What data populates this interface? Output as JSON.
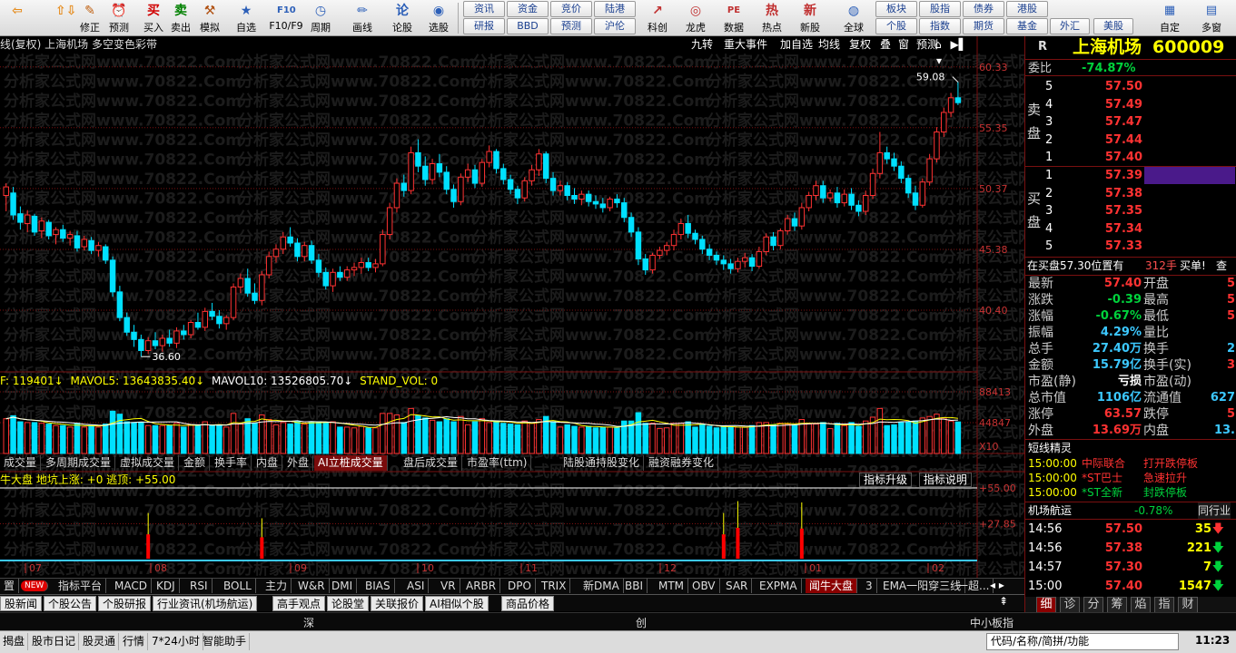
{
  "toolbar": {
    "groups": [
      {
        "label": "",
        "icon": "⇦",
        "color": "#e58a1a"
      },
      {
        "label": "",
        "icon": "⇧⇩",
        "color": "#e58a1a"
      },
      {
        "label": "修正",
        "icon": "✎",
        "color": "#c06010"
      },
      {
        "label": "预测",
        "icon": "⏰",
        "color": "#c03030"
      },
      {
        "label": "买入",
        "icon": "买",
        "color": "#d00000"
      },
      {
        "label": "卖出",
        "icon": "卖",
        "color": "#008000"
      },
      {
        "label": "模拟",
        "icon": "⚒",
        "color": "#b05010"
      },
      {
        "label": "自选",
        "icon": "★",
        "color": "#2c5fb8"
      },
      {
        "label": "F10/F9",
        "icon": "F10",
        "color": "#2c5fb8"
      },
      {
        "label": "周期",
        "icon": "◷",
        "color": "#2c5fb8"
      },
      {
        "label": "画线",
        "icon": "✏",
        "color": "#2c5fb8"
      },
      {
        "label": "论股",
        "icon": "论",
        "color": "#2c5fb8"
      },
      {
        "label": "选股",
        "icon": "◉",
        "color": "#2c5fb8"
      }
    ],
    "grid_top": [
      "资讯",
      "资金",
      "竞价",
      "陆港"
    ],
    "grid_bottom": [
      "研报",
      "BBD",
      "预测",
      "沪伦"
    ],
    "groups2": [
      {
        "label": "科创",
        "icon": "↗",
        "color": "#c03030"
      },
      {
        "label": "龙虎",
        "icon": "◎",
        "color": "#c03030"
      },
      {
        "label": "数据",
        "icon": "PE",
        "color": "#c03030"
      },
      {
        "label": "热点",
        "icon": "热",
        "color": "#c03030"
      },
      {
        "label": "新股",
        "icon": "新",
        "color": "#c03030"
      },
      {
        "label": "全球",
        "icon": "◍",
        "color": "#2c5fb8"
      }
    ],
    "grid2_top": [
      "板块",
      "股指",
      "债券",
      "港股"
    ],
    "grid2_bottom": [
      "个股",
      "指数",
      "期货",
      "基金",
      "外汇",
      "美股"
    ],
    "right": [
      {
        "label": "自定",
        "icon": "▦"
      },
      {
        "label": "多窗",
        "icon": "▤"
      }
    ]
  },
  "chart": {
    "title": "线(复权) 上海机场 多空变色彩带",
    "top_buttons": [
      "九转",
      "重大事件",
      "加自选",
      "均线",
      "复权",
      "叠",
      "窗",
      "预测"
    ],
    "price_axis": [
      "60.33",
      "55.35",
      "50.37",
      "45.38",
      "40.40"
    ],
    "high_label": "59.08",
    "low_label": "36.60",
    "vol_info": {
      "prefix": "F: 119401↓",
      "mavol5": "MAVOL5: 13643835.40↓",
      "mavol10": "MAVOL10: 13526805.70↓",
      "stand": "STAND_VOL: 0"
    },
    "vol_axis": [
      "88413",
      "44847",
      "X10"
    ],
    "indicator_tabs": [
      "成交量",
      "多周期成交量",
      "虚拟成交量",
      "金额",
      "换手率",
      "内盘",
      "外盘",
      "AI立桩成交量",
      "盘后成交量",
      "市盈率(ttm)",
      "陆股通持股变化",
      "融资融券变化"
    ],
    "indicator_selected": "AI立桩成交量",
    "sub_info": "牛大盘  地坑上涨: +0  逃顶: +55.00",
    "sub_buttons": [
      "指标升级",
      "指标说明"
    ],
    "sub_axis": [
      "+55.00",
      "+27.85"
    ],
    "months": [
      "07",
      "08",
      "09",
      "10",
      "11",
      "12",
      "01",
      "02"
    ],
    "watermark": "分析家公式网www.70822.Com"
  },
  "chart_data": {
    "type": "candlestick",
    "ylim": [
      35.5,
      61.5
    ],
    "candles": [
      [
        49.8,
        50.8,
        48.5,
        50.5
      ],
      [
        50.0,
        50.5,
        47.8,
        48.2
      ],
      [
        48.3,
        48.9,
        47.0,
        47.6
      ],
      [
        47.5,
        48.6,
        46.8,
        48.2
      ],
      [
        48.1,
        48.3,
        46.5,
        46.8
      ],
      [
        46.9,
        48.0,
        46.3,
        47.7
      ],
      [
        47.6,
        47.8,
        46.2,
        46.5
      ],
      [
        46.6,
        47.2,
        45.8,
        47.0
      ],
      [
        47.0,
        47.4,
        46.0,
        46.3
      ],
      [
        46.3,
        46.9,
        45.7,
        46.6
      ],
      [
        46.5,
        46.9,
        45.2,
        45.5
      ],
      [
        45.6,
        46.5,
        45.3,
        46.2
      ],
      [
        46.1,
        46.4,
        45.0,
        45.3
      ],
      [
        45.3,
        46.0,
        44.8,
        45.7
      ],
      [
        45.6,
        45.8,
        44.2,
        44.5
      ],
      [
        44.5,
        44.8,
        41.5,
        41.9
      ],
      [
        41.9,
        42.4,
        39.5,
        39.8
      ],
      [
        39.8,
        40.2,
        38.3,
        38.6
      ],
      [
        38.6,
        39.2,
        37.4,
        38.0
      ],
      [
        38.0,
        38.4,
        36.6,
        37.1
      ],
      [
        37.1,
        38.2,
        36.8,
        37.9
      ],
      [
        37.9,
        38.6,
        37.2,
        37.5
      ],
      [
        37.5,
        38.4,
        37.0,
        38.1
      ],
      [
        38.1,
        38.8,
        37.4,
        37.7
      ],
      [
        37.7,
        39.0,
        37.3,
        38.7
      ],
      [
        38.7,
        39.2,
        38.0,
        38.4
      ],
      [
        38.4,
        39.6,
        38.1,
        39.4
      ],
      [
        39.4,
        40.2,
        38.8,
        39.0
      ],
      [
        39.0,
        40.6,
        38.7,
        40.3
      ],
      [
        40.3,
        41.0,
        39.6,
        39.9
      ],
      [
        39.9,
        40.4,
        38.9,
        39.3
      ],
      [
        39.3,
        40.0,
        38.8,
        39.8
      ],
      [
        39.8,
        42.6,
        39.6,
        42.3
      ],
      [
        42.3,
        43.4,
        41.8,
        43.0
      ],
      [
        43.0,
        43.8,
        41.5,
        41.8
      ],
      [
        41.8,
        42.6,
        40.9,
        41.2
      ],
      [
        41.2,
        43.6,
        40.8,
        43.3
      ],
      [
        43.3,
        45.2,
        43.0,
        44.8
      ],
      [
        44.8,
        45.8,
        44.3,
        45.4
      ],
      [
        45.4,
        46.8,
        45.0,
        46.4
      ],
      [
        46.4,
        47.2,
        45.6,
        45.9
      ],
      [
        45.9,
        46.3,
        44.4,
        44.8
      ],
      [
        44.8,
        46.0,
        44.4,
        45.7
      ],
      [
        45.7,
        46.1,
        44.2,
        44.5
      ],
      [
        44.5,
        45.0,
        43.1,
        43.5
      ],
      [
        43.5,
        43.9,
        42.1,
        42.4
      ],
      [
        42.4,
        43.8,
        41.9,
        43.5
      ],
      [
        43.5,
        44.0,
        42.8,
        43.1
      ],
      [
        43.1,
        44.0,
        42.8,
        43.7
      ],
      [
        43.7,
        44.3,
        43.2,
        43.9
      ],
      [
        43.9,
        44.7,
        43.4,
        44.3
      ],
      [
        44.3,
        44.7,
        43.6,
        43.9
      ],
      [
        43.9,
        44.6,
        43.5,
        44.2
      ],
      [
        44.2,
        47.0,
        44.0,
        46.6
      ],
      [
        46.6,
        49.2,
        46.2,
        48.8
      ],
      [
        48.8,
        51.2,
        48.4,
        50.8
      ],
      [
        50.8,
        51.5,
        49.7,
        50.2
      ],
      [
        50.2,
        53.8,
        49.9,
        53.3
      ],
      [
        53.3,
        54.4,
        51.7,
        52.2
      ],
      [
        52.2,
        53.0,
        50.6,
        51.1
      ],
      [
        51.1,
        52.8,
        50.7,
        52.4
      ],
      [
        52.4,
        53.2,
        51.3,
        51.7
      ],
      [
        51.7,
        52.2,
        49.9,
        50.3
      ],
      [
        50.3,
        50.7,
        48.8,
        49.3
      ],
      [
        49.3,
        51.6,
        49.0,
        51.3
      ],
      [
        51.3,
        52.4,
        50.9,
        51.9
      ],
      [
        51.9,
        52.3,
        50.4,
        50.8
      ],
      [
        50.8,
        52.8,
        50.5,
        52.5
      ],
      [
        52.5,
        53.9,
        52.1,
        53.4
      ],
      [
        53.4,
        53.6,
        51.6,
        52.0
      ],
      [
        52.0,
        52.4,
        50.7,
        51.1
      ],
      [
        51.1,
        51.5,
        49.9,
        50.3
      ],
      [
        50.3,
        50.6,
        49.1,
        49.6
      ],
      [
        49.6,
        51.3,
        49.3,
        51.0
      ],
      [
        51.0,
        52.3,
        50.6,
        51.9
      ],
      [
        51.9,
        53.6,
        51.4,
        53.2
      ],
      [
        53.2,
        53.4,
        50.8,
        51.2
      ],
      [
        51.2,
        51.7,
        49.8,
        50.2
      ],
      [
        50.2,
        51.0,
        49.8,
        50.6
      ],
      [
        50.6,
        50.9,
        49.4,
        49.8
      ],
      [
        49.8,
        50.4,
        49.1,
        49.5
      ],
      [
        49.5,
        50.2,
        49.0,
        49.9
      ],
      [
        49.9,
        50.2,
        48.9,
        49.3
      ],
      [
        49.3,
        49.8,
        48.7,
        49.1
      ],
      [
        49.1,
        49.6,
        48.4,
        48.8
      ],
      [
        48.8,
        49.7,
        48.5,
        49.5
      ],
      [
        49.5,
        49.9,
        48.8,
        49.2
      ],
      [
        49.2,
        49.6,
        47.6,
        48.0
      ],
      [
        48.0,
        48.4,
        46.4,
        46.8
      ],
      [
        46.8,
        47.2,
        44.1,
        44.6
      ],
      [
        44.6,
        45.0,
        43.3,
        43.7
      ],
      [
        43.7,
        45.1,
        43.4,
        44.9
      ],
      [
        44.9,
        45.6,
        44.6,
        45.3
      ],
      [
        45.3,
        46.0,
        44.9,
        45.7
      ],
      [
        45.7,
        47.0,
        45.3,
        46.6
      ],
      [
        46.6,
        47.9,
        46.2,
        47.5
      ],
      [
        47.5,
        48.2,
        46.3,
        46.7
      ],
      [
        46.7,
        47.0,
        45.8,
        46.2
      ],
      [
        46.2,
        46.5,
        45.0,
        45.4
      ],
      [
        45.4,
        45.8,
        44.5,
        44.9
      ],
      [
        44.9,
        45.2,
        44.1,
        44.5
      ],
      [
        44.5,
        44.9,
        43.7,
        44.2
      ],
      [
        44.2,
        44.6,
        43.4,
        43.8
      ],
      [
        43.8,
        44.7,
        43.5,
        44.4
      ],
      [
        44.4,
        45.1,
        43.9,
        44.7
      ],
      [
        44.7,
        45.0,
        43.6,
        44.0
      ],
      [
        44.0,
        45.6,
        43.8,
        45.2
      ],
      [
        45.2,
        46.7,
        44.9,
        46.4
      ],
      [
        46.4,
        46.8,
        45.3,
        45.7
      ],
      [
        45.7,
        47.1,
        45.4,
        46.9
      ],
      [
        46.9,
        48.2,
        46.6,
        47.9
      ],
      [
        47.9,
        48.4,
        46.9,
        47.3
      ],
      [
        47.3,
        49.2,
        47.0,
        48.8
      ],
      [
        48.8,
        50.1,
        48.5,
        49.8
      ],
      [
        49.8,
        51.0,
        49.4,
        50.6
      ],
      [
        50.6,
        51.0,
        49.2,
        49.6
      ],
      [
        49.6,
        50.3,
        49.3,
        50.0
      ],
      [
        50.0,
        50.5,
        48.8,
        49.2
      ],
      [
        49.2,
        50.3,
        48.9,
        49.9
      ],
      [
        49.9,
        50.4,
        48.6,
        49.0
      ],
      [
        49.0,
        49.4,
        48.1,
        48.5
      ],
      [
        48.5,
        50.2,
        48.2,
        49.8
      ],
      [
        49.8,
        52.0,
        49.5,
        51.6
      ],
      [
        51.6,
        55.0,
        51.2,
        53.3
      ],
      [
        53.3,
        53.8,
        52.4,
        52.8
      ],
      [
        52.8,
        53.3,
        51.8,
        52.2
      ],
      [
        52.2,
        52.6,
        50.8,
        51.2
      ],
      [
        51.2,
        51.5,
        49.6,
        50.0
      ],
      [
        50.0,
        50.6,
        48.6,
        49.0
      ],
      [
        49.0,
        51.2,
        48.8,
        50.9
      ],
      [
        50.9,
        53.2,
        50.6,
        52.8
      ],
      [
        52.8,
        55.4,
        52.5,
        55.0
      ],
      [
        55.0,
        57.0,
        54.6,
        56.6
      ],
      [
        56.6,
        58.2,
        56.2,
        57.8
      ],
      [
        57.8,
        59.08,
        57.2,
        57.4
      ]
    ],
    "volume_ylim": [
      0,
      88413
    ],
    "sub_ylim": [
      0,
      55
    ]
  },
  "quote": {
    "flag": "R",
    "name": "上海机场",
    "code": "600009",
    "webi_label": "委比",
    "webi_value": "-74.87%",
    "sell_label": "卖盘",
    "buy_label": "买盘",
    "sell": [
      {
        "lvl": "5",
        "p": "57.50"
      },
      {
        "lvl": "4",
        "p": "57.49"
      },
      {
        "lvl": "3",
        "p": "57.47"
      },
      {
        "lvl": "2",
        "p": "57.44"
      },
      {
        "lvl": "1",
        "p": "57.40"
      }
    ],
    "buy": [
      {
        "lvl": "1",
        "p": "57.39"
      },
      {
        "lvl": "2",
        "p": "57.38"
      },
      {
        "lvl": "3",
        "p": "57.35"
      },
      {
        "lvl": "4",
        "p": "57.34"
      },
      {
        "lvl": "5",
        "p": "57.33"
      }
    ],
    "notice": {
      "text": "在买盘57.30位置有",
      "qty": "312手",
      "tail": "买单!",
      "btn": "查"
    },
    "stats": [
      {
        "l": "最新",
        "v": "57.40",
        "c": "red",
        "r": "开盘",
        "rv": "5"
      },
      {
        "l": "涨跌",
        "v": "-0.39",
        "c": "green",
        "r": "最高",
        "rv": "5"
      },
      {
        "l": "涨幅",
        "v": "-0.67%",
        "c": "green",
        "r": "最低",
        "rv": "5"
      },
      {
        "l": "振幅",
        "v": "4.29%",
        "c": "cyan",
        "r": "量比",
        "rv": ""
      },
      {
        "l": "总手",
        "v": "27.40万",
        "c": "cyan",
        "r": "换手",
        "rv": "2"
      },
      {
        "l": "金额",
        "v": "15.79亿",
        "c": "cyan",
        "r": "换手(实)",
        "rv": "3"
      },
      {
        "l": "市盈(静)",
        "v": "亏损",
        "c": "white",
        "r": "市盈(动)",
        "rv": ""
      },
      {
        "l": "总市值",
        "v": "1106亿",
        "c": "cyan",
        "r": "流通值",
        "rv": "627"
      },
      {
        "l": "涨停",
        "v": "63.57",
        "c": "red",
        "r": "跌停",
        "rv": "5"
      },
      {
        "l": "外盘",
        "v": "13.69万",
        "c": "red",
        "r": "内盘",
        "rv": "13."
      }
    ],
    "news_title": "短线精灵",
    "news": [
      {
        "t": "15:00:00",
        "n": "中际联合",
        "e": "打开跌停板",
        "nc": "red",
        "ec": "red"
      },
      {
        "t": "15:00:00",
        "n": "*ST巴士",
        "e": "急速拉升",
        "nc": "red",
        "ec": "red"
      },
      {
        "t": "15:00:00",
        "n": "*ST全新",
        "e": "封跌停板",
        "nc": "green",
        "ec": "green"
      }
    ],
    "sector": {
      "name": "机场航运",
      "pct": "-0.78%",
      "same": "同行业"
    },
    "ticks": [
      {
        "t": "14:56",
        "p": "57.50",
        "q": "35"
      },
      {
        "t": "14:56",
        "p": "57.38",
        "q": "221"
      },
      {
        "t": "14:57",
        "p": "57.30",
        "q": "7"
      },
      {
        "t": "15:00",
        "p": "57.40",
        "q": "1547"
      }
    ],
    "tabs": [
      "细",
      "诊",
      "分",
      "筹",
      "焰",
      "指",
      "财"
    ]
  },
  "bottom": {
    "btabs": [
      "置",
      "NEW",
      "指标平台",
      "MACD",
      "KDJ",
      "RSI",
      "BOLL",
      "主力",
      "W&R",
      "DMI",
      "BIAS",
      "ASI",
      "VR",
      "ARBR",
      "DPO",
      "TRIX",
      "新DMA",
      "BBI",
      "MTM",
      "OBV",
      "SAR",
      "EXPMA",
      "闻牛大盘",
      "3",
      "EMA一阳穿三线",
      "一超..."
    ],
    "btab_selected": "闻牛大盘",
    "news_links": [
      "股新闻",
      "个股公告",
      "个股研报",
      "行业资讯(机场航运)",
      "高手观点",
      "论股堂",
      "关联报价",
      "AI相似个股",
      "商品价格"
    ],
    "row2": [
      "深",
      "创",
      "中小板指"
    ],
    "status": [
      "揭盘",
      "股市日记",
      "股灵通",
      "行情",
      "7*24小时",
      "智能助手"
    ],
    "search_placeholder": "代码/名称/简拼/功能",
    "clock": "11:23"
  },
  "colors": {
    "up": "#ff3232",
    "down": "#00e0ff",
    "grid": "#7a1010",
    "axis": "#c83232"
  }
}
